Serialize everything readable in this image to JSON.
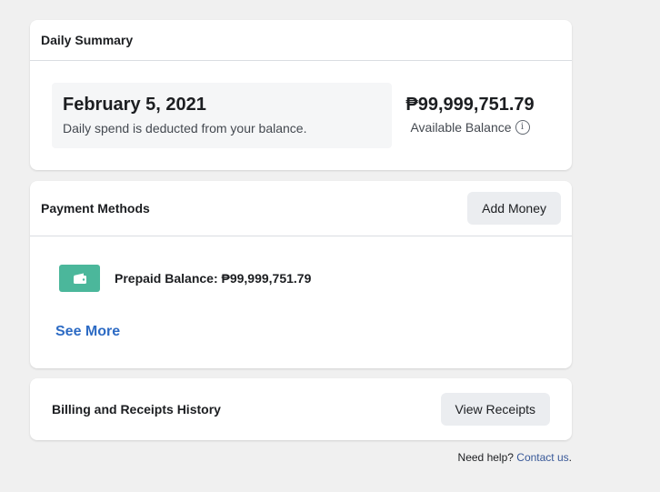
{
  "daily_summary": {
    "title": "Daily Summary",
    "date": "February 5, 2021",
    "note": "Daily spend is deducted from your balance.",
    "balance": "₱99,999,751.79",
    "balance_label": "Available Balance",
    "info_icon": "i"
  },
  "payment_methods": {
    "title": "Payment Methods",
    "add_money_label": "Add Money",
    "items": [
      {
        "label": "Prepaid Balance: ₱99,999,751.79",
        "icon": "wallet-icon"
      }
    ],
    "see_more_label": "See More"
  },
  "billing": {
    "title": "Billing and Receipts History",
    "view_receipts_label": "View Receipts"
  },
  "help": {
    "prefix": "Need help?",
    "link": "Contact us",
    "suffix": "."
  },
  "colors": {
    "wallet": "#4bb79b",
    "link": "#2d6bc4",
    "background": "#f0f0f0"
  }
}
